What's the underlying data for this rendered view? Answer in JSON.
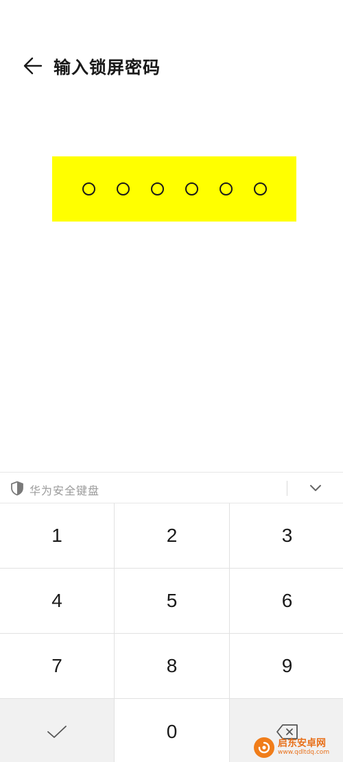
{
  "header": {
    "title": "输入锁屏密码"
  },
  "pin": {
    "length": 6,
    "filled": 0,
    "background": "#ffff00"
  },
  "keyboard": {
    "label": "华为安全键盘",
    "keys": [
      "1",
      "2",
      "3",
      "4",
      "5",
      "6",
      "7",
      "8",
      "9"
    ],
    "zero": "0",
    "confirm_icon": "checkmark-icon",
    "delete_icon": "backspace-icon"
  },
  "watermark": {
    "name": "启东安卓网",
    "url": "www.qdltdq.com"
  },
  "colors": {
    "text": "#1a1a1a",
    "muted": "#9a9a9a",
    "highlight": "#ffff00",
    "brand": "#f07d1a"
  }
}
